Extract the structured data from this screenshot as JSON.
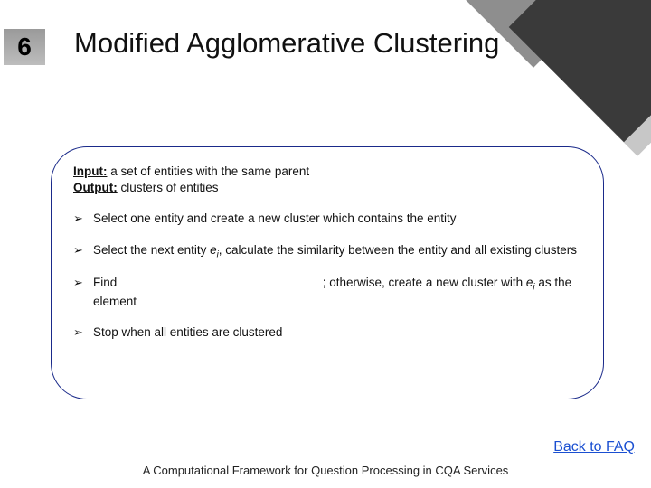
{
  "page_number": "6",
  "title": "Modified Agglomerative Clustering",
  "io": {
    "input_label": "Input:",
    "input_text": " a set of entities with the same parent",
    "output_label": "Output:",
    "output_text": " clusters of entities"
  },
  "bullets": {
    "b1": "Select one entity and create a new cluster which contains the entity",
    "b2a": "Select the next entity ",
    "b2_entity": "e",
    "b2_sub": "i",
    "b2b": ", calculate the similarity between the entity and all existing clusters",
    "b3a": "Find ",
    "b3b": " ; otherwise, create a new cluster with ",
    "b3_entity": "e",
    "b3_sub": "i",
    "b3c": " as the element",
    "b4": "Stop when all entities are clustered"
  },
  "back_link": "Back to FAQ",
  "footer": "A Computational Framework for Question Processing in CQA Services"
}
